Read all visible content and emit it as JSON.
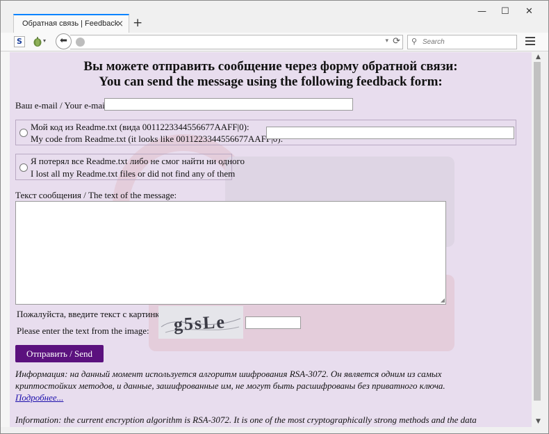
{
  "browser": {
    "tab_title": "Обратная связь | Feedback",
    "tab_close": "×",
    "new_tab": "+",
    "window_controls": {
      "minimize": "—",
      "maximize": "☐",
      "close": "✕"
    },
    "search_placeholder": "Search",
    "url": "",
    "icons": [
      "s-icon",
      "onion-icon",
      "back-arrow-icon",
      "globe-icon",
      "reload-icon",
      "search-icon",
      "menu-icon"
    ]
  },
  "page": {
    "heading_ru": "Вы можете отправить сообщение через форму обратной связи:",
    "heading_en": "You can send the message using the following feedback form:",
    "email_label": "Ваш e-mail / Your e-mail:",
    "code_option": {
      "line1": "Мой код из Readme.txt (вида 0011223344556677AAFF|0):",
      "line2": "My code from Readme.txt (it looks like 0011223344556677AAFF|0):"
    },
    "lost_option": {
      "line1": "Я потерял все Readme.txt либо не смог найти ни одного",
      "line2": "I lost all my Readme.txt files or did not find any of them"
    },
    "message_label": "Текст сообщения / The text of the message:",
    "captcha_label_ru": "Пожалуйста, введите текст с картинки:",
    "captcha_label_en": "Please enter the text from the image:",
    "captcha_text": "g5sLe",
    "send_button": "Отправить / Send",
    "info_ru_1": "Информация: на данный момент используется алгоритм шифрования RSA-3072. Он является одним из самых",
    "info_ru_2": "криптостойких методов, и данные, зашифрованные им, не могут быть расшифрованы без приватного ключа.",
    "more_link": "Подробнее...",
    "info_en_1": "Information: the current encryption algorithm is RSA-3072. It is one of the most cryptographically strong methods and the data"
  },
  "colors": {
    "page_background": "#e8ddee",
    "send_button": "#5b117e",
    "tab_accent": "#0a84ff",
    "link": "#1a0dab"
  }
}
